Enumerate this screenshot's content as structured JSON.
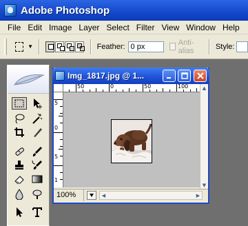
{
  "app": {
    "title": "Adobe Photoshop"
  },
  "menu": [
    "File",
    "Edit",
    "Image",
    "Layer",
    "Select",
    "Filter",
    "View",
    "Window",
    "Help"
  ],
  "options": {
    "feather_label": "Feather:",
    "feather_value": "0 px",
    "antialias_label": "Anti-alias",
    "antialias_checked": false,
    "style_label": "Style:"
  },
  "document": {
    "title": "Img_1817.jpg @ 1...",
    "zoom": "100%",
    "ruler_top": [
      "50",
      "0",
      "50",
      "100"
    ],
    "ruler_left": [
      "5",
      "0",
      "5",
      "1"
    ]
  },
  "colors": {
    "titlebar_blue": "#0a3ab8",
    "canvas_gray": "#c0c0c0",
    "workspace_gray": "#6f6f6f",
    "close_red": "#c8442a"
  },
  "icons": {
    "app": "photoshop-logo-icon",
    "toolbox_logo": "feather-icon"
  }
}
